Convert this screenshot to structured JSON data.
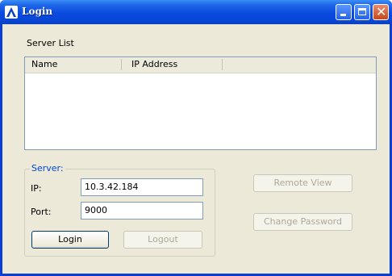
{
  "window": {
    "title": "Login",
    "icon": "app-logo-icon"
  },
  "server_list": {
    "label": "Server List",
    "columns": [
      "Name",
      "IP Address"
    ],
    "rows": []
  },
  "server_group": {
    "legend": "Server:",
    "ip_label": "IP:",
    "ip_value": "10.3.42.184",
    "port_label": "Port:",
    "port_value": "9000"
  },
  "buttons": {
    "login": "Login",
    "logout": "Logout",
    "remote_view": "Remote View",
    "change_password": "Change Password"
  },
  "colors": {
    "title_bar": "#0a4ae0",
    "legend": "#0046d5",
    "disabled_text": "#aca899",
    "window_bg": "#ece9d8"
  }
}
